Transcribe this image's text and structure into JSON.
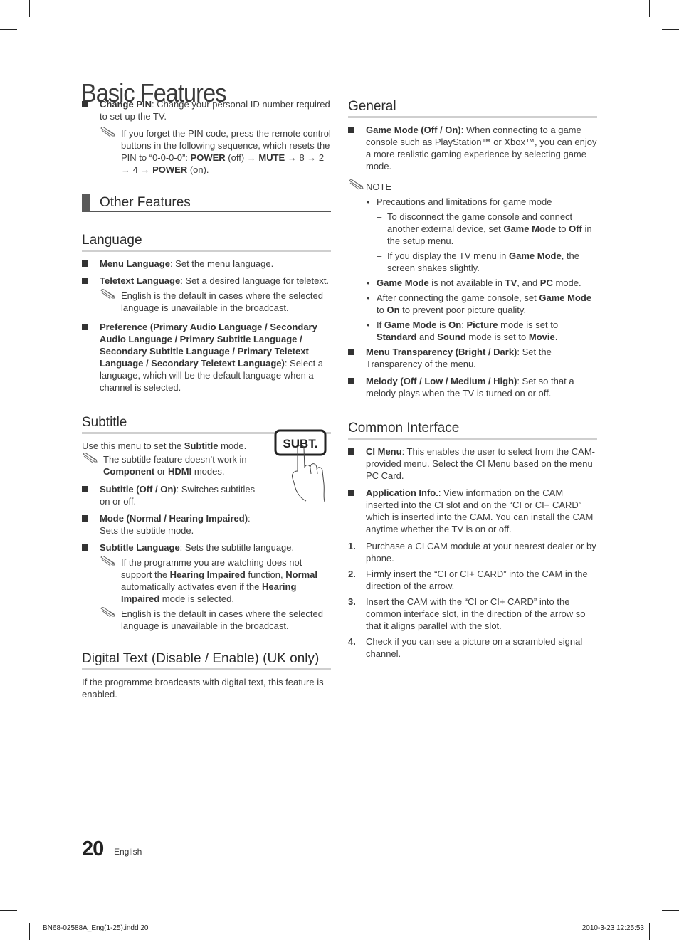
{
  "page": {
    "title": "Basic Features",
    "page_number": "20",
    "language": "English",
    "slug_file": "BN68-02588A_Eng(1-25).indd   20",
    "slug_datetime": "2010-3-23   12:25:53"
  },
  "left": {
    "change_pin": {
      "term": "Change PIN",
      "desc": ": Change your personal ID number required to set up the TV.",
      "note": {
        "p1": "If you forget the PIN code, press the remote control buttons in the following sequence, which resets the PIN to “0-0-0-0”: ",
        "power1": "POWER",
        "p2": " (off) → ",
        "mute": "MUTE",
        "p3": " → 8 → 2 → 4 → ",
        "power2": "POWER",
        "p4": " (on)."
      }
    },
    "other_features": {
      "title": "Other Features"
    },
    "language": {
      "title": "Language",
      "menu_language": {
        "term": "Menu Language",
        "desc": ": Set the menu language."
      },
      "teletext_language": {
        "term": "Teletext Language",
        "desc": ": Set a desired language for teletext.",
        "note": "English is the default in cases where the selected language is unavailable in the broadcast."
      },
      "preference": {
        "term": "Preference (Primary Audio Language / Secondary Audio Language / Primary Subtitle Language / Secondary Subtitle Language / Primary Teletext Language / Secondary Teletext Language)",
        "desc": ": Select a language, which will be the default language when a channel is selected."
      }
    },
    "subtitle": {
      "title": "Subtitle",
      "intro_pre": "Use this menu to set the ",
      "intro_bold": "Subtitle",
      "intro_post": " mode.",
      "note": {
        "p1": "The subtitle feature doesn’t work in ",
        "b1": "Component",
        "p2": " or ",
        "b2": "HDMI",
        "p3": " modes."
      },
      "button_label": "SUBT.",
      "subtitle_onoff": {
        "term": "Subtitle (Off / On)",
        "desc": ": Switches subtitles on or off."
      },
      "mode": {
        "term": "Mode (Normal / Hearing Impaired)",
        "desc": ": Sets the subtitle mode."
      },
      "subtitle_language": {
        "term": "Subtitle Language",
        "desc": ": Sets the subtitle language.",
        "note1": {
          "p1": "If the programme you are watching does not support the ",
          "b1": "Hearing Impaired",
          "p2": " function, ",
          "b2": "Normal",
          "p3": " automatically activates even if the ",
          "b3": "Hearing Impaired",
          "p4": " mode is selected."
        },
        "note2": "English is the default in cases where the selected language is unavailable in the broadcast."
      }
    },
    "digital_text": {
      "title": "Digital Text (Disable / Enable) (UK only)",
      "desc": "If the programme broadcasts with digital text, this feature is enabled."
    }
  },
  "right": {
    "general": {
      "title": "General",
      "game_mode": {
        "term": "Game Mode (Off / On)",
        "desc": ": When connecting to a game console such as PlayStation™ or Xbox™, you can enjoy a more realistic gaming experience by selecting game mode."
      },
      "note_label": "NOTE",
      "bullets": {
        "b1": "Precautions and limitations for game mode",
        "d1": {
          "p1": "To disconnect the game console and connect another external device, set ",
          "b1": "Game Mode",
          "p2": " to ",
          "b2": "Off",
          "p3": " in the setup menu."
        },
        "d2": {
          "p1": "If you display the TV menu in ",
          "b1": "Game Mode",
          "p2": ", the screen shakes slightly."
        },
        "b2": {
          "b1": "Game Mode",
          "p1": " is not available in ",
          "b2": "TV",
          "p2": ", and ",
          "b3": "PC",
          "p3": " mode."
        },
        "b3": {
          "p1": "After connecting the game console, set ",
          "b1": "Game Mode",
          "p2": " to ",
          "b2": "On",
          "p3": " to prevent poor picture quality."
        },
        "b4": {
          "p1": "If ",
          "b1": "Game Mode",
          "p2": " is ",
          "b2": "On",
          "p3": ": ",
          "b3": "Picture",
          "p4": " mode is set to ",
          "b4": "Standard",
          "p5": " and ",
          "b5": "Sound",
          "p6": " mode is set to ",
          "b6": "Movie",
          "p7": "."
        }
      },
      "menu_transparency": {
        "term": "Menu Transparency (Bright / Dark)",
        "desc": ": Set the Transparency of the menu."
      },
      "melody": {
        "term": "Melody (Off / Low / Medium / High)",
        "desc": ": Set so that a melody plays when the TV is turned on or off."
      }
    },
    "common_interface": {
      "title": "Common Interface",
      "ci_menu": {
        "term": "CI Menu",
        "desc": ":  This enables the user to select from the CAM-provided menu. Select the CI Menu based on the menu PC Card."
      },
      "application_info": {
        "term": "Application Info.",
        "desc": ": View information on the CAM inserted into the CI slot and on the “CI or CI+ CARD” which is inserted into the CAM. You can install the CAM anytime whether the TV is on or off."
      },
      "steps": [
        {
          "n": "1.",
          "text": "Purchase a CI CAM module at your nearest dealer or by phone."
        },
        {
          "n": "2.",
          "text": "Firmly insert the “CI or CI+ CARD” into the CAM in the direction of the arrow."
        },
        {
          "n": "3.",
          "text": "Insert the CAM with the “CI or CI+ CARD” into the common interface slot, in the direction of the arrow so that it aligns parallel with the slot."
        },
        {
          "n": "4.",
          "text": "Check if you can see a picture on a scrambled signal channel."
        }
      ]
    }
  }
}
